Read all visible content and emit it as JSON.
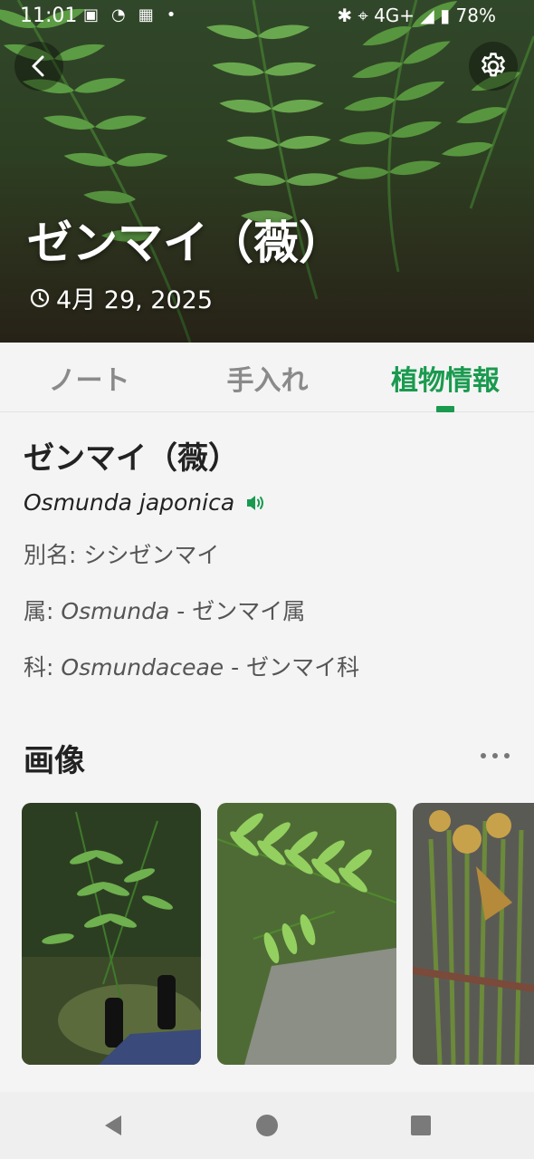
{
  "status_bar": {
    "time": "11:01",
    "network": "4G+",
    "battery": "78%",
    "icons_left": [
      "sim-icon",
      "signal-check-icon",
      "calendar-icon",
      "dot-icon"
    ],
    "icons_right": [
      "bluetooth-icon",
      "location-icon",
      "cell-signal-icon",
      "battery-icon"
    ]
  },
  "header": {
    "title": "ゼンマイ（薇）",
    "date": "4月 29, 2025"
  },
  "tabs": [
    {
      "label": "ノート"
    },
    {
      "label": "手入れ"
    },
    {
      "label": "植物情報",
      "active": true
    }
  ],
  "plant": {
    "name": "ゼンマイ（薇）",
    "scientific_name": "Osmunda japonica",
    "alias_label": "別名",
    "alias_value": "シシゼンマイ",
    "genus_label": "属",
    "genus_latin": "Osmunda",
    "genus_jp": "ゼンマイ属",
    "family_label": "科",
    "family_latin": "Osmundaceae",
    "family_jp": "ゼンマイ科"
  },
  "images_section": {
    "title": "画像",
    "more": "•••"
  },
  "colors": {
    "accent": "#1a9a4f",
    "background": "#f4f4f4",
    "text": "#222222",
    "muted": "#555555"
  }
}
